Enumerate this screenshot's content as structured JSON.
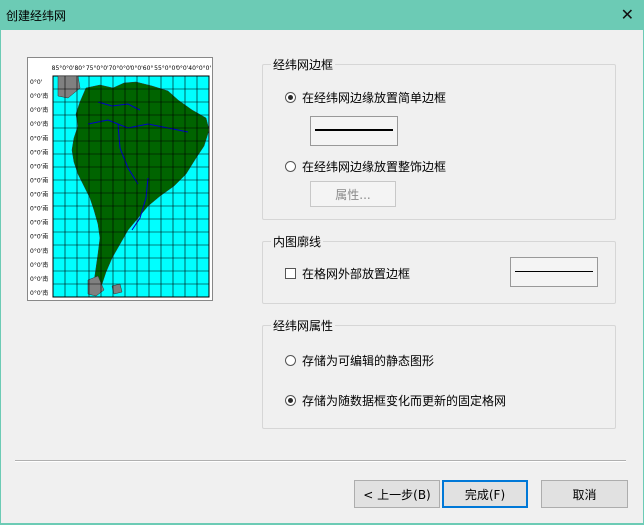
{
  "window": {
    "title": "创建经纬网"
  },
  "preview": {
    "top_labels": [
      "85°",
      "0°0'",
      "80°",
      "75°",
      "0°0'",
      "70°",
      "0°0'",
      "0°0'",
      "60°",
      "55°",
      "0°0'",
      "0°0'",
      "40°",
      "0°0'"
    ],
    "left_labels": [
      "0°0'",
      "0°0'南",
      "0°0'南",
      "0°0'南",
      "0°0'南",
      "0°0'南",
      "0°0'南",
      "0°0'南",
      "0°0'南",
      "0°0'南",
      "0°0'南",
      "0°0'南",
      "0°0'南",
      "0°0'南",
      "0°0'南",
      "0°0'南"
    ],
    "colors": {
      "ocean": "#00ffff",
      "land": "#006400",
      "rivers": "#0000cc",
      "outside": "#808080",
      "grid": "#000000"
    }
  },
  "border_group": {
    "title": "经纬网边框",
    "option_simple": {
      "label": "在经纬网边缘放置简单边框",
      "selected": true
    },
    "option_decor": {
      "label": "在经纬网边缘放置整饰边框",
      "selected": false
    },
    "properties_button": "属性..."
  },
  "neatline_group": {
    "title": "内图廓线",
    "checkbox": {
      "label": "在格网外部放置边框",
      "checked": false
    }
  },
  "properties_group": {
    "title": "经纬网属性",
    "option_static": {
      "label": "存储为可编辑的静态图形",
      "selected": false
    },
    "option_fixed": {
      "label": "存储为随数据框变化而更新的固定格网",
      "selected": true
    }
  },
  "footer": {
    "back_button": "< 上一步(B)",
    "finish_button": "完成(F)",
    "cancel_button": "取消"
  }
}
